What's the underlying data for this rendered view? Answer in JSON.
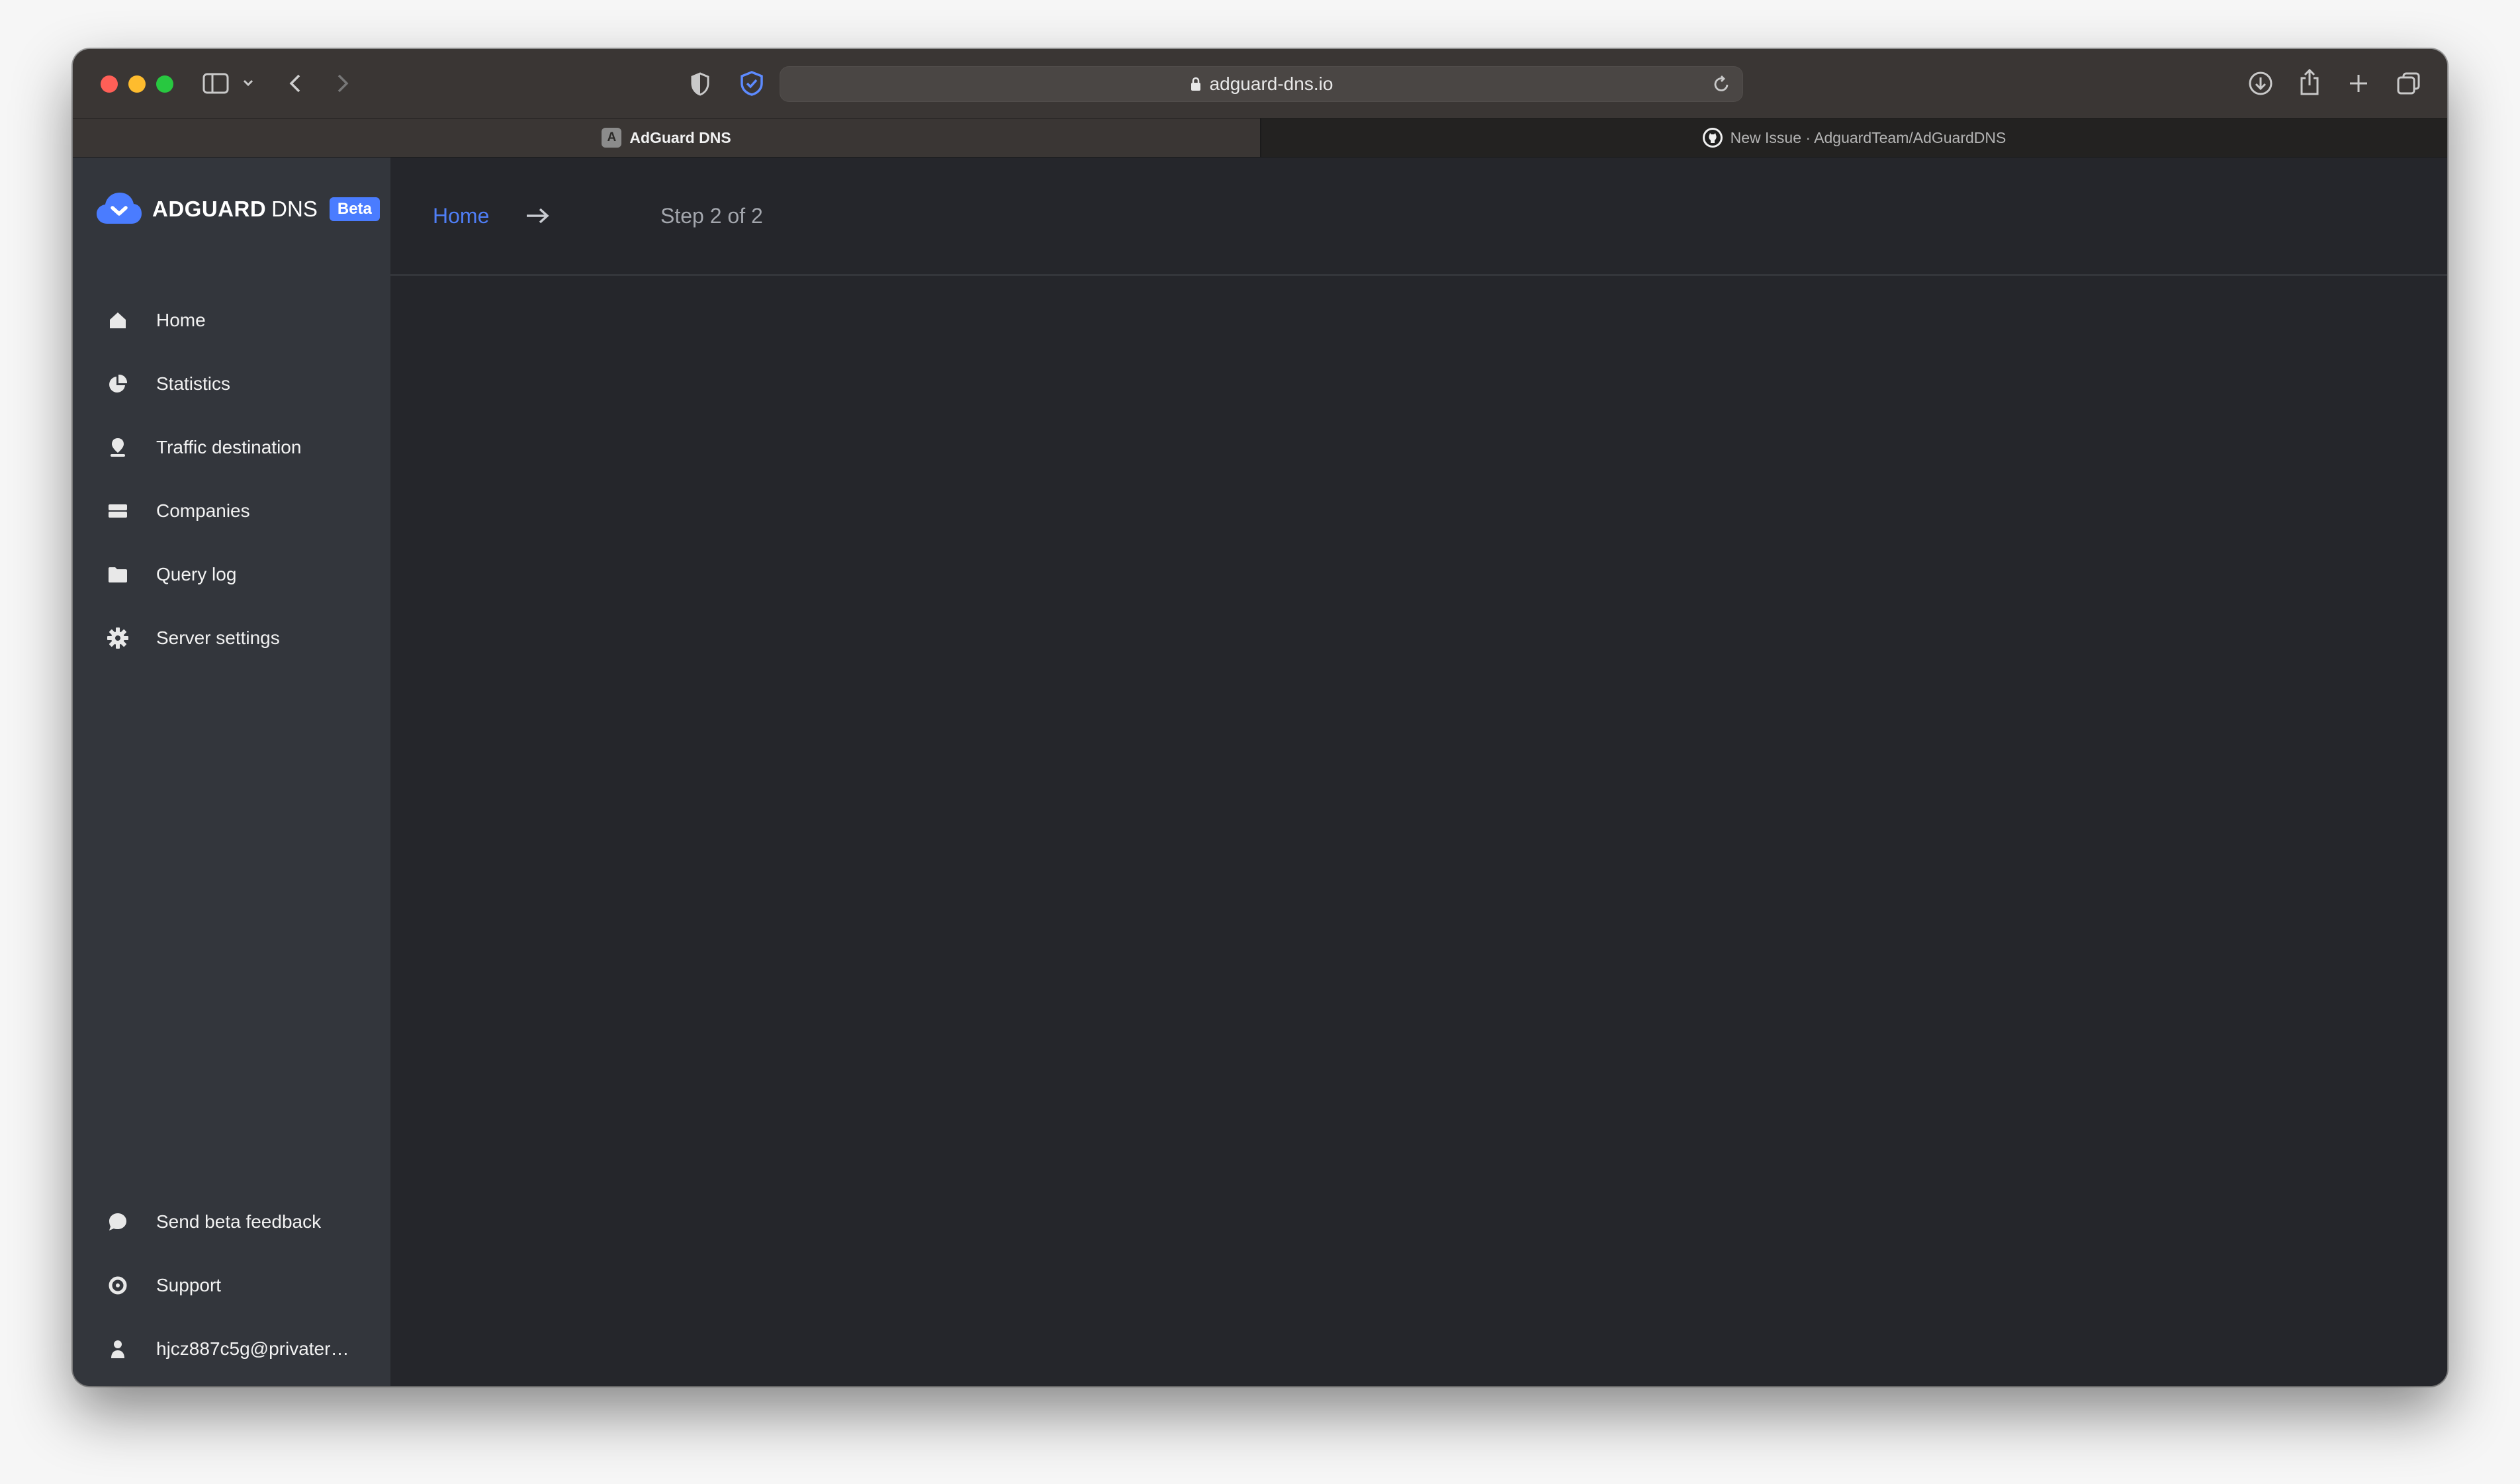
{
  "browser": {
    "url": "adguard-dns.io",
    "tabs": [
      {
        "title": "AdGuard DNS",
        "favicon_letter": "A",
        "active": true
      },
      {
        "title": "New Issue · AdguardTeam/AdGuardDNS",
        "active": false
      }
    ]
  },
  "app": {
    "logo": {
      "brand": "ADGUARD",
      "product": "DNS",
      "badge": "Beta"
    },
    "breadcrumb": {
      "home": "Home",
      "step": "Step 2 of 2"
    },
    "nav": [
      {
        "label": "Home",
        "icon": "home-icon"
      },
      {
        "label": "Statistics",
        "icon": "pie-chart-icon"
      },
      {
        "label": "Traffic destination",
        "icon": "map-pin-icon"
      },
      {
        "label": "Companies",
        "icon": "card-icon"
      },
      {
        "label": "Query log",
        "icon": "folder-icon"
      },
      {
        "label": "Server settings",
        "icon": "gear-icon"
      }
    ],
    "bottom_nav": [
      {
        "label": "Send beta feedback",
        "icon": "chat-bubble-icon"
      },
      {
        "label": "Support",
        "icon": "support-icon"
      },
      {
        "label": "hjcz887c5g@privater…",
        "icon": "user-icon"
      }
    ]
  },
  "colors": {
    "accent": "#4a7cff",
    "link": "#4f7ef6",
    "sidebar": "#33363c",
    "main": "#25262b"
  }
}
